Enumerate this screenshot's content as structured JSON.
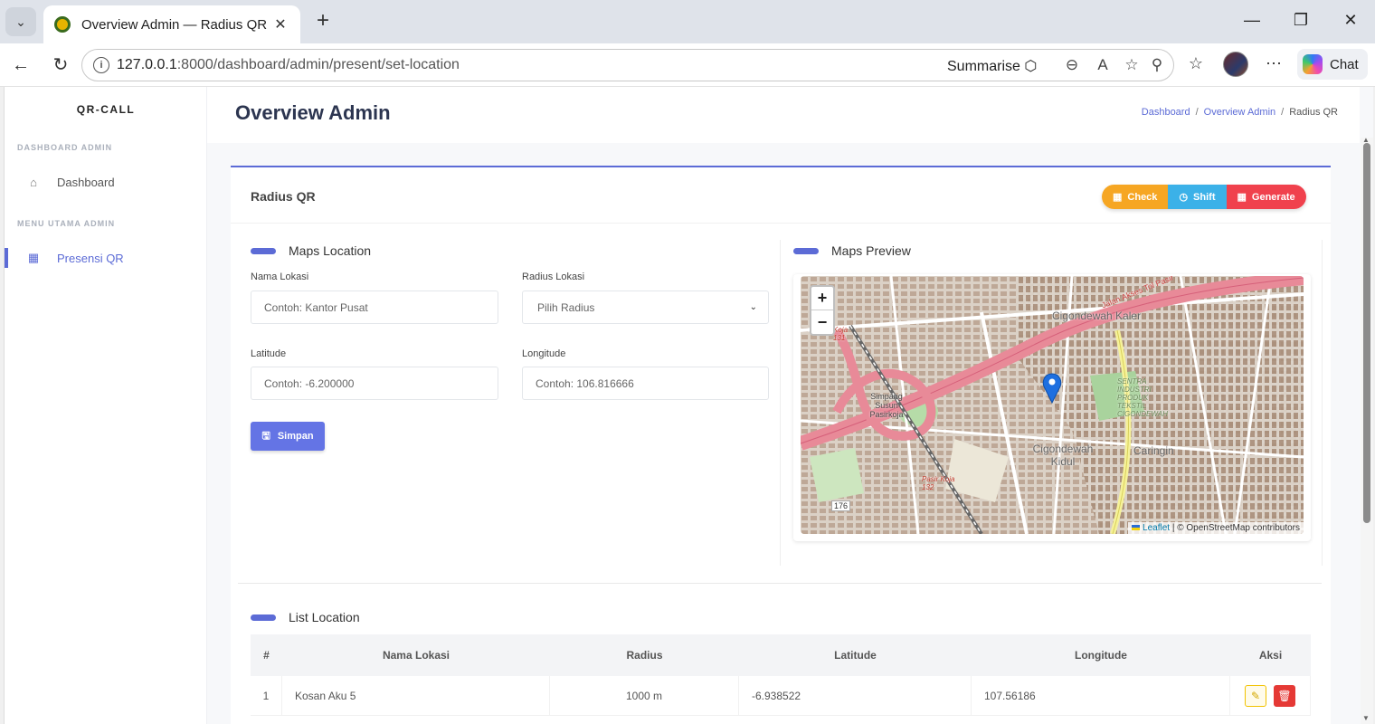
{
  "browser": {
    "tab_title": "Overview Admin — Radius QR",
    "tab_close": "✕",
    "new_tab": "+",
    "url_host": "127.0.0.1",
    "url_path": ":8000/dashboard/admin/present/set-location",
    "summarise_label": "Summarise",
    "chat_label": "Chat"
  },
  "sidebar": {
    "brand": "QR-CALL",
    "section1": "DASHBOARD ADMIN",
    "section2": "MENU UTAMA ADMIN",
    "items": [
      {
        "label": "Dashboard",
        "icon": "home-icon"
      },
      {
        "label": "Presensi QR",
        "icon": "qr-grid-icon"
      }
    ]
  },
  "header": {
    "title": "Overview Admin",
    "breadcrumb": [
      "Dashboard",
      "Overview Admin",
      "Radius QR"
    ]
  },
  "card": {
    "title": "Radius QR",
    "buttons": {
      "check": "Check",
      "shift": "Shift",
      "generate": "Generate"
    }
  },
  "form": {
    "section_title": "Maps Location",
    "nama_label": "Nama Lokasi",
    "nama_placeholder": "Contoh: Kantor Pusat",
    "radius_label": "Radius Lokasi",
    "radius_value": "Pilih Radius",
    "lat_label": "Latitude",
    "lat_placeholder": "Contoh: -6.200000",
    "lng_label": "Longitude",
    "lng_placeholder": "Contoh: 106.816666",
    "save_label": "Simpan"
  },
  "map": {
    "section_title": "Maps Preview",
    "zoom_in": "+",
    "zoom_out": "−",
    "attribution_link": "Leaflet",
    "attribution_text": " | © OpenStreetMap contributors",
    "labels": {
      "cigondewah_kaler": "Cigondewah Kaler",
      "cigondewah_kidul": "Cigondewah Kidul",
      "caringin": "Caringin",
      "simpang": "Simpang Susun Pasirkoja",
      "pasir_koja": "Pasir Koja 132",
      "koja": "Koja 131",
      "sentra": "SENTRA INDUSTRI PRODUK TEKSTIL CIGONDEWAH",
      "jalan_akses": "Jalan Akses Tol Pasir",
      "road_176": "176"
    }
  },
  "list": {
    "section_title": "List Location",
    "columns": [
      "#",
      "Nama Lokasi",
      "Radius",
      "Latitude",
      "Longitude",
      "Aksi"
    ],
    "rows": [
      {
        "no": "1",
        "nama": "Kosan Aku 5",
        "radius": "1000 m",
        "lat": "-6.938522",
        "lng": "107.56186"
      }
    ]
  },
  "colors": {
    "accent": "#5c6bd6",
    "check": "#f6a623",
    "shift": "#3bb1e8",
    "generate": "#f0414d"
  }
}
